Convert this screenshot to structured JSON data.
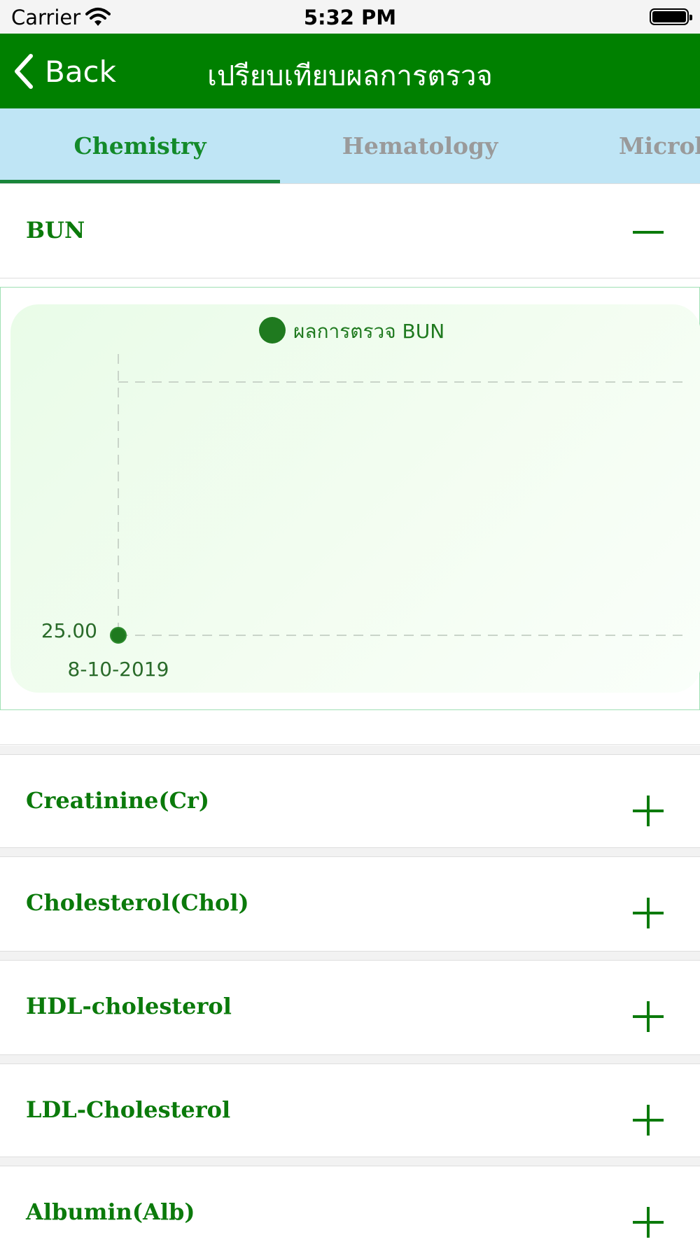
{
  "status_bar": {
    "carrier": "Carrier",
    "time": "5:32 PM"
  },
  "nav": {
    "back_label": "Back",
    "title": "เปรียบเทียบผลการตรวจ"
  },
  "tabs": [
    {
      "label": "Chemistry",
      "active": true
    },
    {
      "label": "Hematology",
      "active": false
    },
    {
      "label": "Microb",
      "active": false
    }
  ],
  "sections": [
    {
      "title": "BUN",
      "expanded": true
    },
    {
      "title": "Creatinine(Cr)",
      "expanded": false
    },
    {
      "title": "Cholesterol(Chol)",
      "expanded": false
    },
    {
      "title": "HDL-cholesterol",
      "expanded": false
    },
    {
      "title": "LDL-Cholesterol",
      "expanded": false
    },
    {
      "title": "Albumin(Alb)",
      "expanded": false
    }
  ],
  "colors": {
    "primary_green": "#008000",
    "tab_bar": "#bfe5f5",
    "text_green": "#0b7a0b"
  },
  "chart_data": {
    "type": "line",
    "legend": "ผลการตรวจ BUN",
    "x": [
      "8-10-2019"
    ],
    "series": [
      {
        "name": "ผลการตรวจ BUN",
        "values": [
          25.0
        ]
      }
    ],
    "y_tick_labels": [
      "25.00"
    ],
    "grid": true,
    "legend_position": "top"
  }
}
